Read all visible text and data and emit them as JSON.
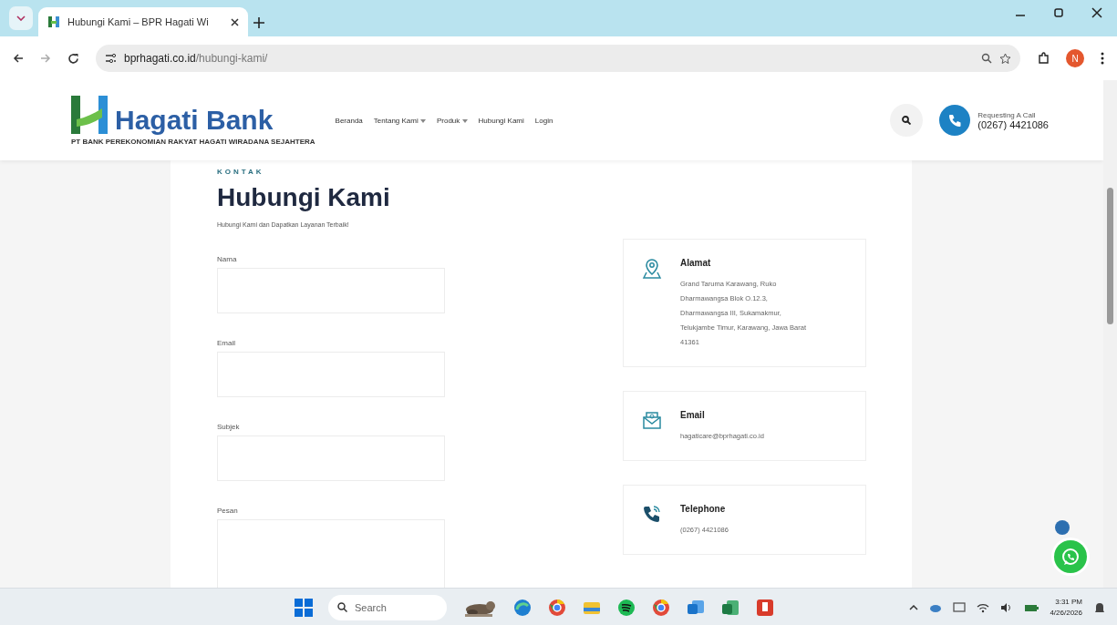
{
  "browser": {
    "tab_title": "Hubungi Kami – BPR Hagati Wi",
    "url_domain": "bprhagati.co.id",
    "url_path": "/hubungi-kami/",
    "profile_initial": "N"
  },
  "header": {
    "logo_text": "Hagati Bank",
    "logo_tagline": "PT BANK PEREKONOMIAN RAKYAT HAGATI WIRADANA SEJAHTERA",
    "nav": [
      {
        "label": "Beranda",
        "dropdown": false
      },
      {
        "label": "Tentang Kami",
        "dropdown": true
      },
      {
        "label": "Produk",
        "dropdown": true
      },
      {
        "label": "Hubungi Kami",
        "dropdown": false
      },
      {
        "label": "Login",
        "dropdown": false
      }
    ],
    "call_label": "Requesting A Call",
    "call_number": "(0267) 4421086"
  },
  "contact": {
    "eyebrow": "KONTAK",
    "title": "Hubungi Kami",
    "subtitle": "Hubungi Kami dan Dapatkan Layanan Terbaik!",
    "fields": [
      {
        "label": "Nama",
        "kind": "input"
      },
      {
        "label": "Email",
        "kind": "input"
      },
      {
        "label": "Subjek",
        "kind": "input"
      },
      {
        "label": "Pesan",
        "kind": "textarea"
      }
    ],
    "cards": [
      {
        "kind": "address",
        "title": "Alamat",
        "text": "Grand Taruma Karawang, Ruko Dharmawangsa Blok O.12.3, Dharmawangsa III, Sukamakmur, Telukjambe Timur, Karawang, Jawa Barat 41361"
      },
      {
        "kind": "email",
        "title": "Email",
        "text": "hagaticare@bprhagati.co.id"
      },
      {
        "kind": "phone",
        "title": "Telephone",
        "text": "(0267) 4421086"
      }
    ]
  },
  "taskbar": {
    "search_placeholder": "Search",
    "time": "3:31 PM",
    "date": "4/26/2026"
  }
}
